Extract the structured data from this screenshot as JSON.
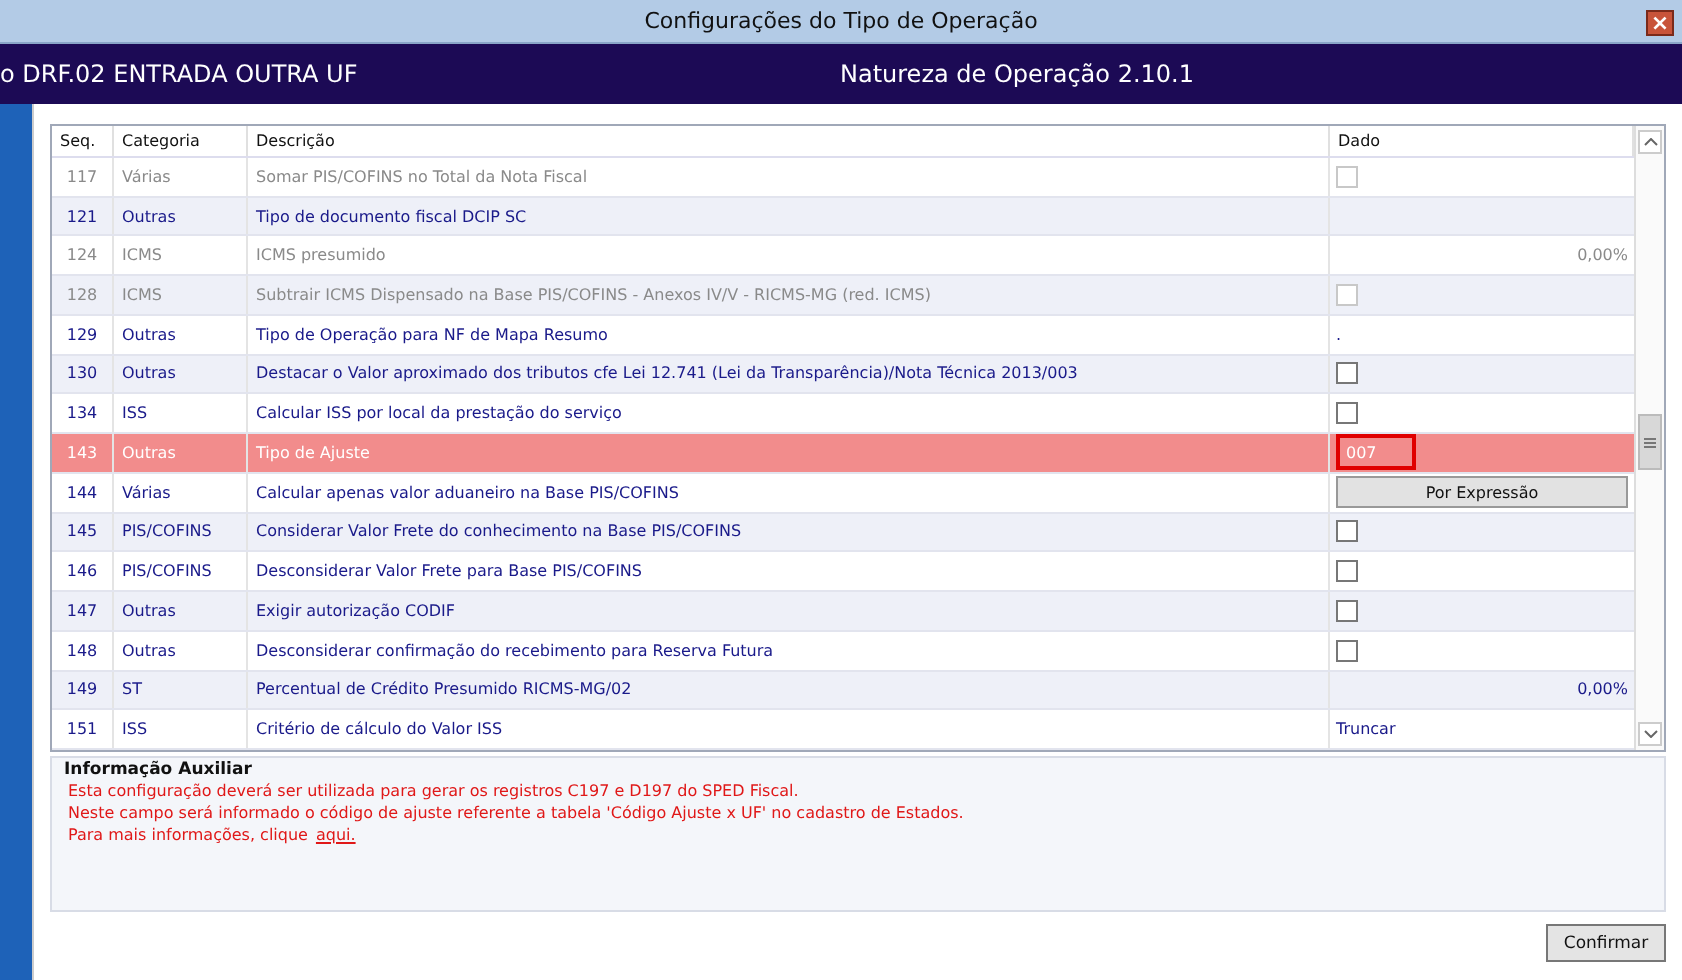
{
  "window": {
    "title": "Configurações do Tipo de Operação",
    "close": "×"
  },
  "header": {
    "operation": "o DRF.02 ENTRADA OUTRA UF",
    "nature": "Natureza de Operação 2.10.1"
  },
  "table": {
    "columns": [
      "Seq.",
      "Categoria",
      "Descrição",
      "Dado"
    ],
    "rows": [
      {
        "seq": "117",
        "category": "Várias",
        "description": "Somar PIS/COFINS no Total da Nota Fiscal",
        "disabled": true,
        "selected": false,
        "value": {
          "kind": "checkbox",
          "checked": false
        }
      },
      {
        "seq": "121",
        "category": "Outras",
        "description": "Tipo de documento fiscal DCIP SC",
        "disabled": false,
        "selected": false,
        "value": {
          "kind": "empty"
        }
      },
      {
        "seq": "124",
        "category": "ICMS",
        "description": "ICMS presumido",
        "disabled": true,
        "selected": false,
        "value": {
          "kind": "number",
          "text": "0,00%"
        }
      },
      {
        "seq": "128",
        "category": "ICMS",
        "description": "Subtrair ICMS Dispensado na Base PIS/COFINS - Anexos IV/V - RICMS-MG (red. ICMS)",
        "disabled": true,
        "selected": false,
        "value": {
          "kind": "checkbox",
          "checked": false
        }
      },
      {
        "seq": "129",
        "category": "Outras",
        "description": "Tipo de Operação para NF de Mapa Resumo",
        "disabled": false,
        "selected": false,
        "value": {
          "kind": "text",
          "text": "."
        }
      },
      {
        "seq": "130",
        "category": "Outras",
        "description": "Destacar o Valor aproximado dos tributos cfe Lei 12.741 (Lei da Transparência)/Nota Técnica 2013/003",
        "disabled": false,
        "selected": false,
        "value": {
          "kind": "checkbox",
          "checked": false
        }
      },
      {
        "seq": "134",
        "category": "ISS",
        "description": "Calcular ISS por local da prestação do serviço",
        "disabled": false,
        "selected": false,
        "value": {
          "kind": "checkbox",
          "checked": false
        }
      },
      {
        "seq": "143",
        "category": "Outras",
        "description": "Tipo de Ajuste",
        "disabled": false,
        "selected": true,
        "value": {
          "kind": "input",
          "text": "007"
        }
      },
      {
        "seq": "144",
        "category": "Várias",
        "description": "Calcular apenas valor aduaneiro na Base PIS/COFINS",
        "disabled": false,
        "selected": false,
        "value": {
          "kind": "button",
          "text": "Por Expressão"
        }
      },
      {
        "seq": "145",
        "category": "PIS/COFINS",
        "description": "Considerar Valor Frete do conhecimento na Base PIS/COFINS",
        "disabled": false,
        "selected": false,
        "value": {
          "kind": "checkbox",
          "checked": false
        }
      },
      {
        "seq": "146",
        "category": "PIS/COFINS",
        "description": "Desconsiderar Valor Frete para Base PIS/COFINS",
        "disabled": false,
        "selected": false,
        "value": {
          "kind": "checkbox",
          "checked": false
        }
      },
      {
        "seq": "147",
        "category": "Outras",
        "description": "Exigir autorização CODIF",
        "disabled": false,
        "selected": false,
        "value": {
          "kind": "checkbox",
          "checked": false
        }
      },
      {
        "seq": "148",
        "category": "Outras",
        "description": "Desconsiderar confirmação do recebimento para Reserva Futura",
        "disabled": false,
        "selected": false,
        "value": {
          "kind": "checkbox",
          "checked": false
        }
      },
      {
        "seq": "149",
        "category": "ST",
        "description": "Percentual de Crédito Presumido RICMS-MG/02",
        "disabled": false,
        "selected": false,
        "value": {
          "kind": "number",
          "text": "0,00%"
        }
      },
      {
        "seq": "151",
        "category": "ISS",
        "description": "Critério de cálculo do Valor ISS",
        "disabled": false,
        "selected": false,
        "value": {
          "kind": "text",
          "text": "Truncar"
        }
      }
    ]
  },
  "info": {
    "title": "Informação Auxiliar",
    "lines": [
      "Esta configuração deverá ser utilizada para gerar os registros C197 e D197 do SPED Fiscal.",
      "Neste campo será informado o código de ajuste referente a tabela 'Código Ajuste x UF' no cadastro de Estados."
    ],
    "more_text": "Para mais informações, clique",
    "more_link": "aqui."
  },
  "confirm_button": "Confirmar"
}
